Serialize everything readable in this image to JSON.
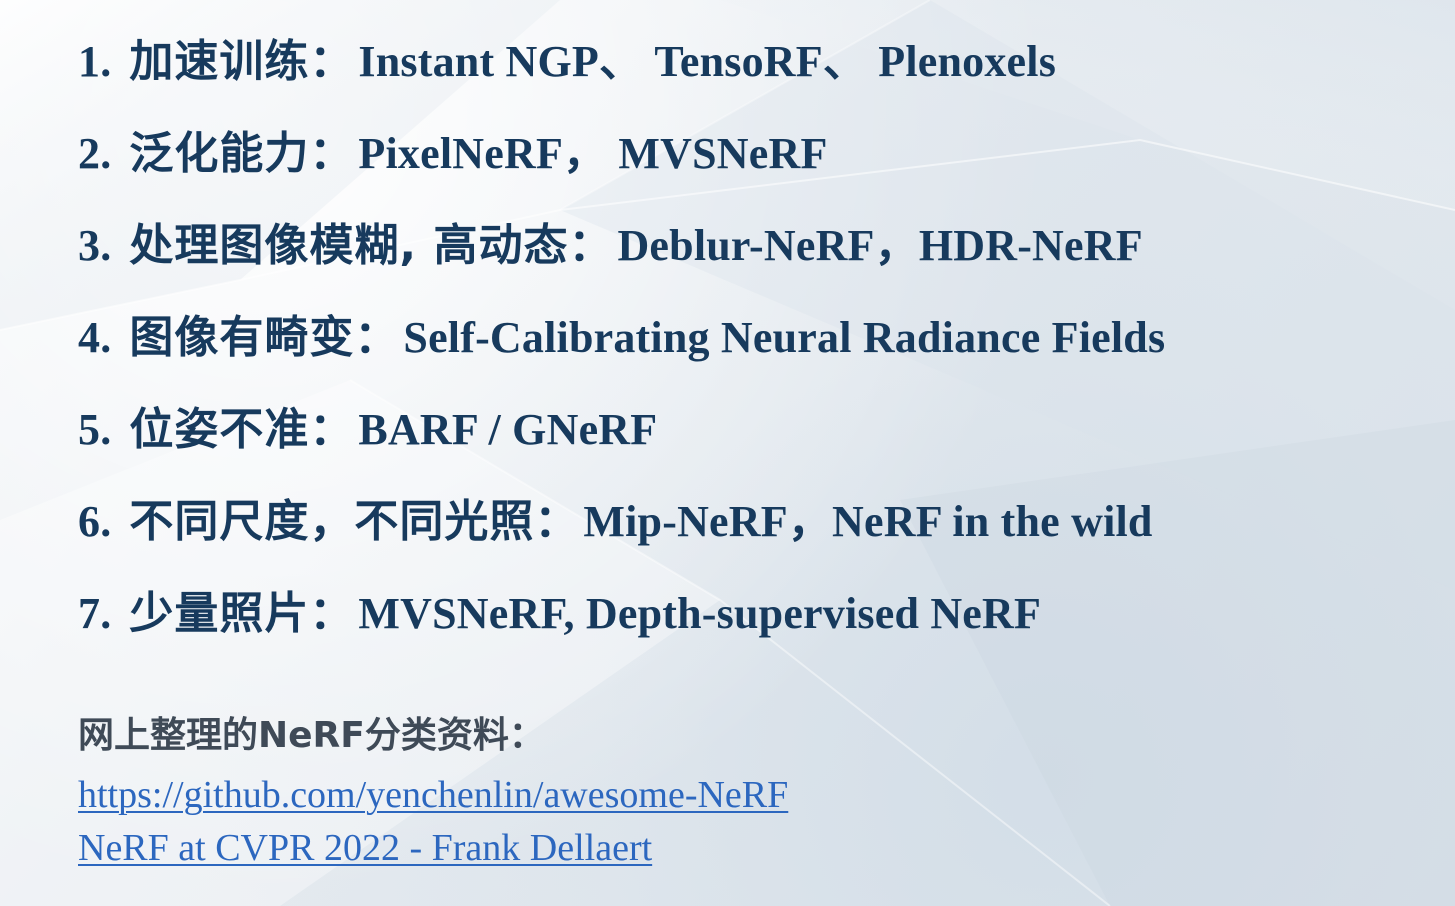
{
  "items": [
    {
      "number": "1.",
      "zh": "加速训练：",
      "en": "Instant NGP、 TensoRF、 Plenoxels"
    },
    {
      "number": "2.",
      "zh": "泛化能力：",
      "en": "PixelNeRF， MVSNeRF"
    },
    {
      "number": "3.",
      "zh": "处理图像模糊, 高动态：",
      "en": "Deblur-NeRF，HDR-NeRF"
    },
    {
      "number": "4.",
      "zh": "图像有畸变：",
      "en": "Self-Calibrating Neural Radiance Fields"
    },
    {
      "number": "5.",
      "zh": "位姿不准：",
      "en": "BARF / GNeRF"
    },
    {
      "number": "6.",
      "zh": "不同尺度，不同光照：",
      "en": "Mip-NeRF，NeRF in the wild"
    },
    {
      "number": "7.",
      "zh": "少量照片：",
      "en": "MVSNeRF, Depth-supervised NeRF"
    }
  ],
  "sources": {
    "title": "网上整理的NeRF分类资料：",
    "links": [
      "https://github.com/yenchenlin/awesome-NeRF",
      "NeRF at CVPR 2022 - Frank Dellaert"
    ]
  },
  "colors": {
    "background": "#e9edf1",
    "text": "#173a5d",
    "secondary_text": "#3f4a57",
    "link": "#2c67bf"
  }
}
